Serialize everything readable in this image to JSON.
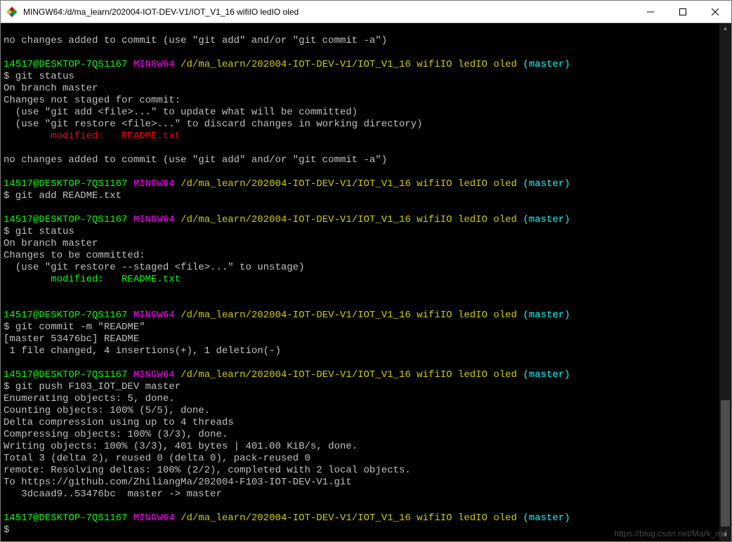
{
  "title": "MINGW64:/d/ma_learn/202004-IOT-DEV-V1/IOT_V1_16 wifiIO ledIO oled",
  "prompt": {
    "user": "14517@DESKTOP-7QS1167",
    "shell": "MINGW64",
    "path": "/d/ma_learn/202004-IOT-DEV-V1/IOT_V1_16 wifiIO ledIO oled",
    "branch": "(master)"
  },
  "cmds": {
    "c1": "$ git status",
    "c2": "$ git add README.txt",
    "c3": "$ git status",
    "c4": "$ git commit -m \"README\"",
    "c5": "$ git push F103_IOT_DEV master",
    "c6": "$"
  },
  "out": {
    "no_changes_line": "no changes added to commit (use \"git add\" and/or \"git commit -a\")",
    "on_branch": "On branch master",
    "not_staged": "Changes not staged for commit:",
    "use_add": "  (use \"git add <file>...\" to update what will be committed)",
    "use_restore": "  (use \"git restore <file>...\" to discard changes in working directory)",
    "modified_red": "        modified:   README.txt",
    "to_be_committed": "Changes to be committed:",
    "use_restore_staged": "  (use \"git restore --staged <file>...\" to unstage)",
    "modified_green": "        modified:   README.txt",
    "commit_ref": "[master 53476bc] README",
    "commit_stat": " 1 file changed, 4 insertions(+), 1 deletion(-)",
    "enum": "Enumerating objects: 5, done.",
    "count": "Counting objects: 100% (5/5), done.",
    "delta_threads": "Delta compression using up to 4 threads",
    "compress": "Compressing objects: 100% (3/3), done.",
    "writing": "Writing objects: 100% (3/3), 401 bytes | 401.00 KiB/s, done.",
    "total": "Total 3 (delta 2), reused 0 (delta 0), pack-reused 0",
    "remote_resolve": "remote: Resolving deltas: 100% (2/2), completed with 2 local objects.",
    "to_url": "To https://github.com/ZhiliangMa/202004-F103-IOT-DEV-V1.git",
    "push_range": "   3dcaad9..53476bc  master -> master"
  },
  "watermark": "https://blog.csdn.net/Mark_md"
}
